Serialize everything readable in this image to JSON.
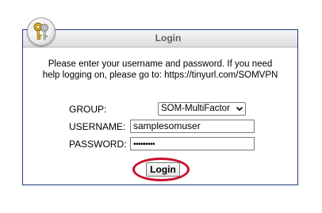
{
  "title_bar": {
    "title": "Login"
  },
  "logo": {
    "icon": "keys-icon"
  },
  "instructions": {
    "line1": "Please enter your username and password. If you need",
    "line2": "help logging on, please go to: https://tinyurl.com/SOMVPN"
  },
  "form": {
    "group": {
      "label": "GROUP:",
      "selected": "SOM-MultiFactor"
    },
    "username": {
      "label": "USERNAME:",
      "value": "samplesomuser"
    },
    "password": {
      "label": "PASSWORD:",
      "value": "•••••••••"
    }
  },
  "login_button": {
    "label": "Login"
  },
  "colors": {
    "frame_border": "#1f3a7a",
    "highlight_ring": "#c8102e"
  }
}
